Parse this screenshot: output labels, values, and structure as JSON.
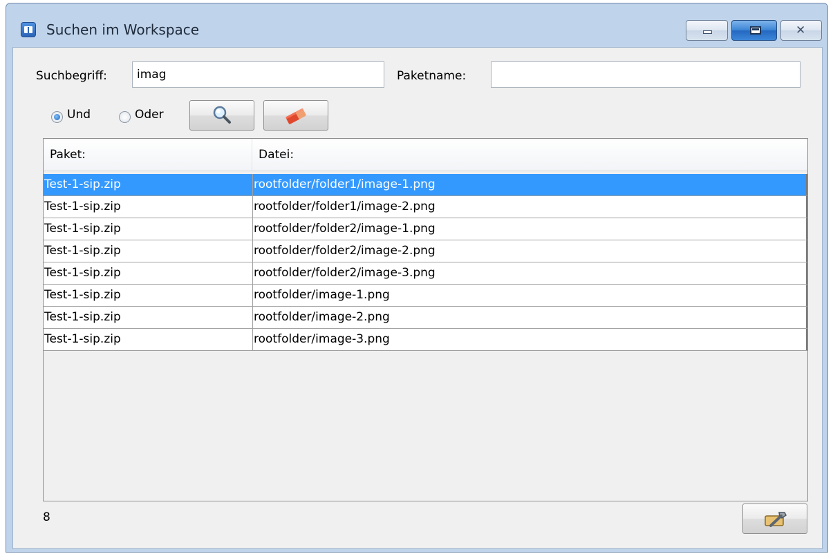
{
  "window": {
    "title": "Suchen im Workspace",
    "close_glyph": "✕"
  },
  "search": {
    "term_label": "Suchbegriff:",
    "term_value": "imag",
    "package_label": "Paketname:",
    "package_value": ""
  },
  "logic": {
    "and_label": "Und",
    "or_label": "Oder",
    "selected": "Und"
  },
  "toolbar": {
    "search_icon": "magnifier-icon",
    "clear_icon": "eraser-icon",
    "settings_icon": "wrench-icon"
  },
  "table": {
    "columns": [
      "Paket:",
      "Datei:"
    ],
    "selected_index": 0,
    "rows": [
      {
        "package": "Test-1-sip.zip",
        "file": "rootfolder/folder1/image-1.png"
      },
      {
        "package": "Test-1-sip.zip",
        "file": "rootfolder/folder1/image-2.png"
      },
      {
        "package": "Test-1-sip.zip",
        "file": "rootfolder/folder2/image-1.png"
      },
      {
        "package": "Test-1-sip.zip",
        "file": "rootfolder/folder2/image-2.png"
      },
      {
        "package": "Test-1-sip.zip",
        "file": "rootfolder/folder2/image-3.png"
      },
      {
        "package": "Test-1-sip.zip",
        "file": "rootfolder/image-1.png"
      },
      {
        "package": "Test-1-sip.zip",
        "file": "rootfolder/image-2.png"
      },
      {
        "package": "Test-1-sip.zip",
        "file": "rootfolder/image-3.png"
      }
    ]
  },
  "status": {
    "result_count": "8"
  },
  "colors": {
    "selection": "#3399ff",
    "titlebar": "#bfd3ea",
    "client": "#f0f0f0"
  }
}
